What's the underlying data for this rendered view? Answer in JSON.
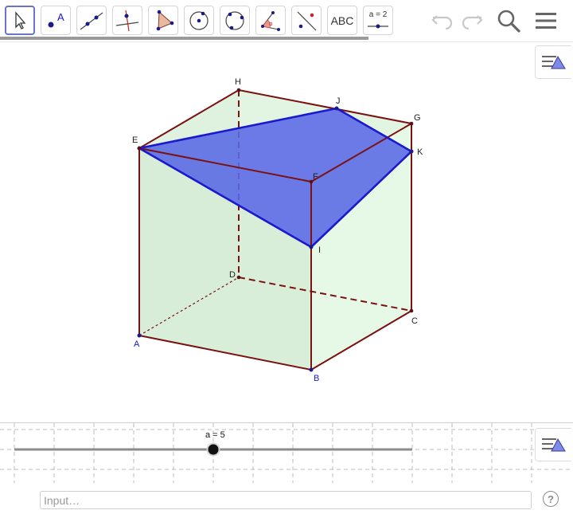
{
  "toolbar": {
    "tools": [
      {
        "name": "move-tool-icon"
      },
      {
        "name": "point-tool-icon",
        "label": "A"
      },
      {
        "name": "line-tool-icon"
      },
      {
        "name": "perpendicular-line-tool-icon"
      },
      {
        "name": "polygon-tool-icon"
      },
      {
        "name": "circle-center-point-tool-icon"
      },
      {
        "name": "circle-three-points-tool-icon"
      },
      {
        "name": "angle-tool-icon",
        "label": "α"
      },
      {
        "name": "reflect-tool-icon"
      },
      {
        "name": "text-tool-icon",
        "label": "ABC"
      },
      {
        "name": "slider-tool-icon",
        "label": "a = 2"
      }
    ],
    "right_icons": [
      "undo-icon",
      "redo-icon",
      "search-icon",
      "menu-icon"
    ],
    "selected_tool": "move-tool-icon"
  },
  "graphics": {
    "points": {
      "A": "A",
      "B": "B",
      "C": "C",
      "D": "D",
      "E": "E",
      "F": "F",
      "G": "G",
      "H": "H",
      "I": "I",
      "J": "J",
      "K": "K"
    },
    "style_button_icon": "style-bar-icon"
  },
  "slider": {
    "label": "a = 5",
    "value": 5
  },
  "input_bar": {
    "placeholder": "Input…",
    "help_label": "?"
  },
  "colors": {
    "cube_edge": "#7a1212",
    "section_fill": "#5a69e6",
    "section_edge": "#1a1acc",
    "face_fill": "#d8f0d8",
    "selection_border": "#6a74c8"
  }
}
